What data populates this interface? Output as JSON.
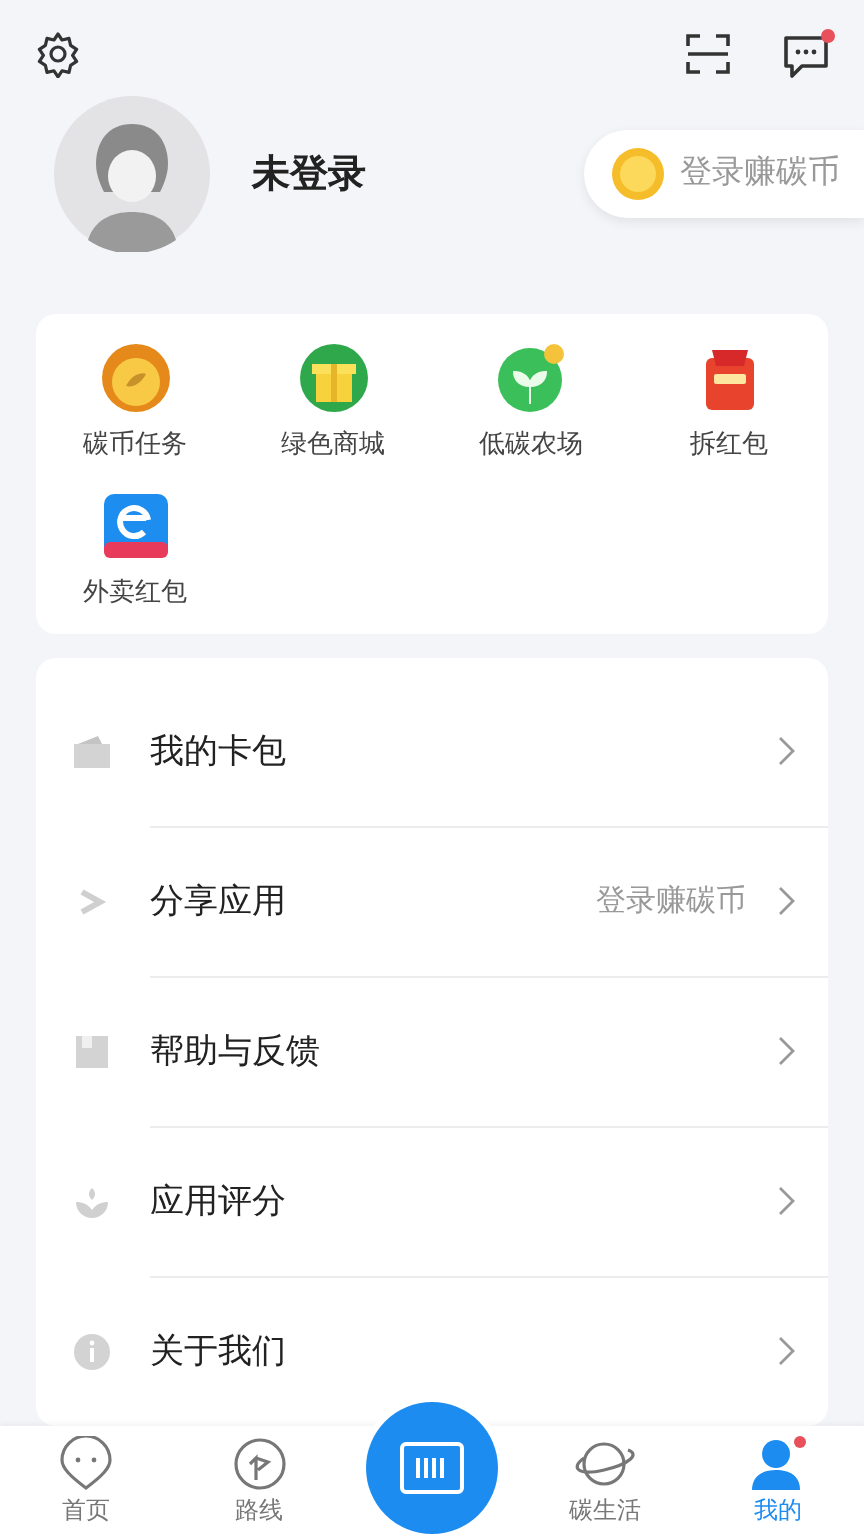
{
  "top_bar": {
    "message_unread": true
  },
  "profile": {
    "name": "未登录",
    "login_pill": "登录赚碳币"
  },
  "shortcuts": [
    {
      "label": "碳币任务"
    },
    {
      "label": "绿色商城"
    },
    {
      "label": "低碳农场"
    },
    {
      "label": "拆红包"
    },
    {
      "label": "外卖红包"
    }
  ],
  "menu": [
    {
      "label": "我的卡包"
    },
    {
      "label": "分享应用",
      "hint": "登录赚碳币"
    },
    {
      "label": "帮助与反馈"
    },
    {
      "label": "应用评分"
    },
    {
      "label": "关于我们"
    }
  ],
  "bottom_nav": [
    {
      "label": "首页",
      "selected": false,
      "badge": false
    },
    {
      "label": "路线",
      "selected": false,
      "badge": false
    },
    {
      "label": "碳生活",
      "selected": false,
      "badge": false
    },
    {
      "label": "我的",
      "selected": true,
      "badge": true
    }
  ]
}
